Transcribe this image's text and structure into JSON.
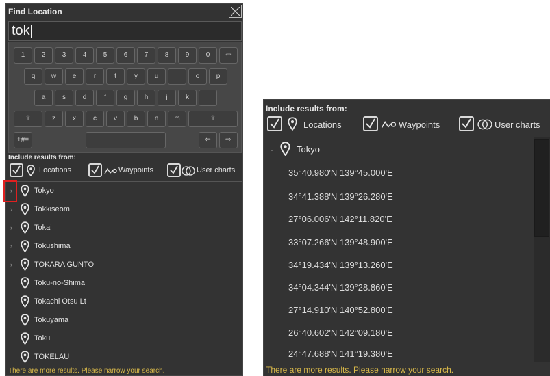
{
  "left_panel": {
    "title": "Find Location",
    "search_value": "tok",
    "keyboard": {
      "row1": [
        "1",
        "2",
        "3",
        "4",
        "5",
        "6",
        "7",
        "8",
        "9",
        "0",
        "⇦"
      ],
      "row2": [
        "q",
        "w",
        "e",
        "r",
        "t",
        "y",
        "u",
        "i",
        "o",
        "p"
      ],
      "row3": [
        "a",
        "s",
        "d",
        "f",
        "g",
        "h",
        "j",
        "k",
        "l"
      ],
      "row4": [
        "⇧",
        "z",
        "x",
        "c",
        "v",
        "b",
        "n",
        "m",
        "⇧"
      ],
      "row5": [
        "+#=",
        "",
        "⇦",
        "⇨"
      ]
    },
    "include_label": "Include results from:",
    "filters": [
      {
        "label": "Locations",
        "checked": true,
        "icon": "pin-icon"
      },
      {
        "label": "Waypoints",
        "checked": true,
        "icon": "waypoint-icon"
      },
      {
        "label": "User charts",
        "checked": true,
        "icon": "user-charts-icon"
      }
    ],
    "results": [
      {
        "label": "Tokyo",
        "expandable": true
      },
      {
        "label": "Tokkiseom",
        "expandable": true
      },
      {
        "label": "Tokai",
        "expandable": true
      },
      {
        "label": "Tokushima",
        "expandable": true
      },
      {
        "label": "TOKARA GUNTO",
        "expandable": true
      },
      {
        "label": "Toku-no-Shima",
        "expandable": false
      },
      {
        "label": "Tokachi Otsu Lt",
        "expandable": false
      },
      {
        "label": "Tokuyama",
        "expandable": false
      },
      {
        "label": "Toku",
        "expandable": false
      },
      {
        "label": "TOKELAU",
        "expandable": false
      }
    ],
    "notice": "There are more results. Please narrow your search."
  },
  "right_panel": {
    "include_label": "Include results from:",
    "filters": [
      {
        "label": "Locations",
        "checked": true,
        "icon": "pin-icon"
      },
      {
        "label": "Waypoints",
        "checked": true,
        "icon": "waypoint-icon"
      },
      {
        "label": "User charts",
        "checked": true,
        "icon": "user-charts-icon"
      }
    ],
    "expanded_item": {
      "label": "Tokyo",
      "expander": "-",
      "coordinates": [
        "35°40.980'N 139°45.000'E",
        "34°41.388'N 139°26.280'E",
        "27°06.006'N 142°11.820'E",
        "33°07.266'N 139°48.900'E",
        "34°19.434'N 139°13.260'E",
        "34°04.344'N 139°28.860'E",
        "27°14.910'N 140°52.800'E",
        "26°40.602'N 142°09.180'E",
        "24°47.688'N 141°19.380'E"
      ]
    },
    "notice": "There are more results. Please narrow your search."
  },
  "colors": {
    "panel_bg": "#333333",
    "notice": "#d8b84a",
    "highlight": "#e02020"
  }
}
